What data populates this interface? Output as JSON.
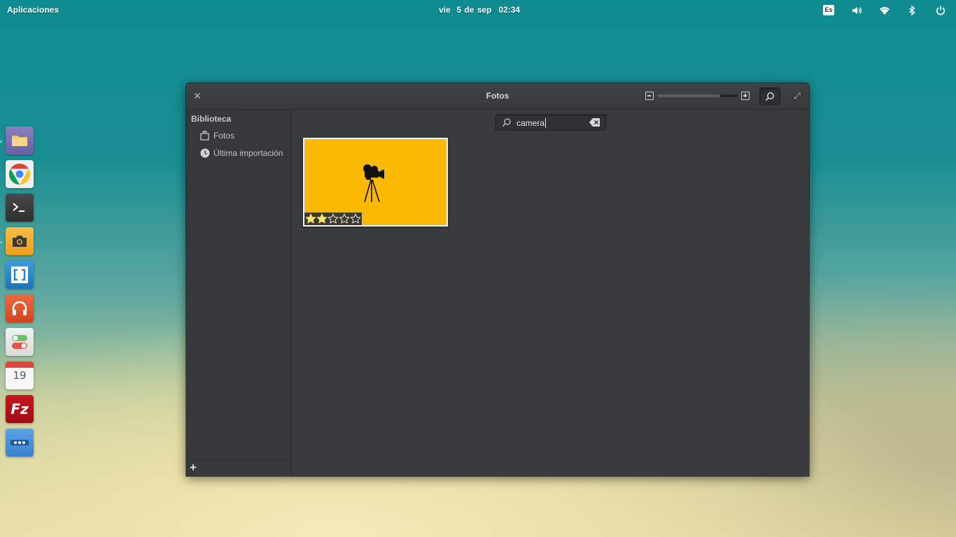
{
  "top_panel": {
    "applications_label": "Aplicaciones",
    "date": "vie  5 de sep",
    "time": "02:34",
    "keyboard_layout": "Es",
    "icons": [
      "keyboard-layout-indicator",
      "volume-icon",
      "wifi-icon",
      "bluetooth-icon",
      "power-icon"
    ]
  },
  "dock": {
    "items": [
      {
        "name": "files",
        "icon": "folder-icon",
        "color": "#7c6fb0"
      },
      {
        "name": "chrome",
        "icon": "chrome-icon",
        "color": "#f5f5f5"
      },
      {
        "name": "terminal",
        "icon": "terminal-icon",
        "color": "#3a3a3a"
      },
      {
        "name": "screenshot",
        "icon": "camera-icon",
        "color": "#f2ae2a"
      },
      {
        "name": "brackets",
        "icon": "brackets-icon",
        "color": "#2b84c7"
      },
      {
        "name": "music",
        "icon": "headphones-icon",
        "color": "#e0532d"
      },
      {
        "name": "settings",
        "icon": "toggle-icon",
        "color": "#e8e8e8"
      },
      {
        "name": "calendar",
        "icon": "calendar-icon",
        "color": "#f5f5f5",
        "day": "19"
      },
      {
        "name": "filezilla",
        "icon": "filezilla-icon",
        "color": "#b8111a",
        "label": "Fz"
      },
      {
        "name": "more",
        "icon": "ellipsis-icon",
        "color": "#4a90d9"
      }
    ]
  },
  "window": {
    "title": "Fotos",
    "zoom_level": 0.78,
    "sidebar": {
      "heading": "Biblioteca",
      "items": [
        {
          "label": "Fotos",
          "icon": "photos-icon"
        },
        {
          "label": "Última importación",
          "icon": "clock-icon"
        }
      ],
      "add_label": "+"
    },
    "search": {
      "value": "camera"
    },
    "photo": {
      "subject": "movie-camera-silhouette",
      "background": "#fbb902",
      "rating": 2,
      "max_rating": 5
    }
  }
}
